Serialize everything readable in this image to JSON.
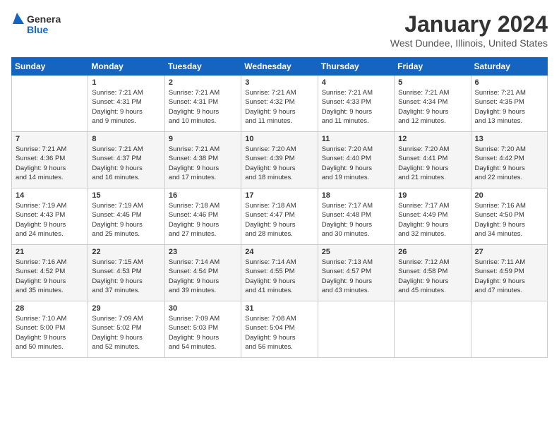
{
  "header": {
    "logo_line1": "General",
    "logo_line2": "Blue",
    "title": "January 2024",
    "location": "West Dundee, Illinois, United States"
  },
  "weekdays": [
    "Sunday",
    "Monday",
    "Tuesday",
    "Wednesday",
    "Thursday",
    "Friday",
    "Saturday"
  ],
  "weeks": [
    [
      {
        "day": "",
        "info": ""
      },
      {
        "day": "1",
        "info": "Sunrise: 7:21 AM\nSunset: 4:31 PM\nDaylight: 9 hours\nand 9 minutes."
      },
      {
        "day": "2",
        "info": "Sunrise: 7:21 AM\nSunset: 4:31 PM\nDaylight: 9 hours\nand 10 minutes."
      },
      {
        "day": "3",
        "info": "Sunrise: 7:21 AM\nSunset: 4:32 PM\nDaylight: 9 hours\nand 11 minutes."
      },
      {
        "day": "4",
        "info": "Sunrise: 7:21 AM\nSunset: 4:33 PM\nDaylight: 9 hours\nand 11 minutes."
      },
      {
        "day": "5",
        "info": "Sunrise: 7:21 AM\nSunset: 4:34 PM\nDaylight: 9 hours\nand 12 minutes."
      },
      {
        "day": "6",
        "info": "Sunrise: 7:21 AM\nSunset: 4:35 PM\nDaylight: 9 hours\nand 13 minutes."
      }
    ],
    [
      {
        "day": "7",
        "info": "Sunrise: 7:21 AM\nSunset: 4:36 PM\nDaylight: 9 hours\nand 14 minutes."
      },
      {
        "day": "8",
        "info": "Sunrise: 7:21 AM\nSunset: 4:37 PM\nDaylight: 9 hours\nand 16 minutes."
      },
      {
        "day": "9",
        "info": "Sunrise: 7:21 AM\nSunset: 4:38 PM\nDaylight: 9 hours\nand 17 minutes."
      },
      {
        "day": "10",
        "info": "Sunrise: 7:20 AM\nSunset: 4:39 PM\nDaylight: 9 hours\nand 18 minutes."
      },
      {
        "day": "11",
        "info": "Sunrise: 7:20 AM\nSunset: 4:40 PM\nDaylight: 9 hours\nand 19 minutes."
      },
      {
        "day": "12",
        "info": "Sunrise: 7:20 AM\nSunset: 4:41 PM\nDaylight: 9 hours\nand 21 minutes."
      },
      {
        "day": "13",
        "info": "Sunrise: 7:20 AM\nSunset: 4:42 PM\nDaylight: 9 hours\nand 22 minutes."
      }
    ],
    [
      {
        "day": "14",
        "info": "Sunrise: 7:19 AM\nSunset: 4:43 PM\nDaylight: 9 hours\nand 24 minutes."
      },
      {
        "day": "15",
        "info": "Sunrise: 7:19 AM\nSunset: 4:45 PM\nDaylight: 9 hours\nand 25 minutes."
      },
      {
        "day": "16",
        "info": "Sunrise: 7:18 AM\nSunset: 4:46 PM\nDaylight: 9 hours\nand 27 minutes."
      },
      {
        "day": "17",
        "info": "Sunrise: 7:18 AM\nSunset: 4:47 PM\nDaylight: 9 hours\nand 28 minutes."
      },
      {
        "day": "18",
        "info": "Sunrise: 7:17 AM\nSunset: 4:48 PM\nDaylight: 9 hours\nand 30 minutes."
      },
      {
        "day": "19",
        "info": "Sunrise: 7:17 AM\nSunset: 4:49 PM\nDaylight: 9 hours\nand 32 minutes."
      },
      {
        "day": "20",
        "info": "Sunrise: 7:16 AM\nSunset: 4:50 PM\nDaylight: 9 hours\nand 34 minutes."
      }
    ],
    [
      {
        "day": "21",
        "info": "Sunrise: 7:16 AM\nSunset: 4:52 PM\nDaylight: 9 hours\nand 35 minutes."
      },
      {
        "day": "22",
        "info": "Sunrise: 7:15 AM\nSunset: 4:53 PM\nDaylight: 9 hours\nand 37 minutes."
      },
      {
        "day": "23",
        "info": "Sunrise: 7:14 AM\nSunset: 4:54 PM\nDaylight: 9 hours\nand 39 minutes."
      },
      {
        "day": "24",
        "info": "Sunrise: 7:14 AM\nSunset: 4:55 PM\nDaylight: 9 hours\nand 41 minutes."
      },
      {
        "day": "25",
        "info": "Sunrise: 7:13 AM\nSunset: 4:57 PM\nDaylight: 9 hours\nand 43 minutes."
      },
      {
        "day": "26",
        "info": "Sunrise: 7:12 AM\nSunset: 4:58 PM\nDaylight: 9 hours\nand 45 minutes."
      },
      {
        "day": "27",
        "info": "Sunrise: 7:11 AM\nSunset: 4:59 PM\nDaylight: 9 hours\nand 47 minutes."
      }
    ],
    [
      {
        "day": "28",
        "info": "Sunrise: 7:10 AM\nSunset: 5:00 PM\nDaylight: 9 hours\nand 50 minutes."
      },
      {
        "day": "29",
        "info": "Sunrise: 7:09 AM\nSunset: 5:02 PM\nDaylight: 9 hours\nand 52 minutes."
      },
      {
        "day": "30",
        "info": "Sunrise: 7:09 AM\nSunset: 5:03 PM\nDaylight: 9 hours\nand 54 minutes."
      },
      {
        "day": "31",
        "info": "Sunrise: 7:08 AM\nSunset: 5:04 PM\nDaylight: 9 hours\nand 56 minutes."
      },
      {
        "day": "",
        "info": ""
      },
      {
        "day": "",
        "info": ""
      },
      {
        "day": "",
        "info": ""
      }
    ]
  ]
}
